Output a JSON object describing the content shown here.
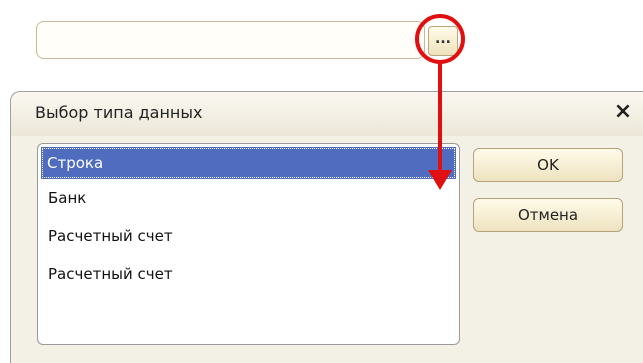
{
  "field": {
    "value": "",
    "ellipsis_label": "..."
  },
  "dialog": {
    "title": "Выбор типа данных",
    "close_label": "×",
    "items": [
      {
        "label": "Строка",
        "selected": true
      },
      {
        "label": "Банк",
        "selected": false
      },
      {
        "label": "Расчетный счет",
        "selected": false
      },
      {
        "label": "Расчетный счет",
        "selected": false
      }
    ],
    "ok_label": "OK",
    "cancel_label": "Отмена"
  },
  "colors": {
    "highlight": "#e01010",
    "selection": "#4f6cbf"
  },
  "icons": {
    "close": "close-icon",
    "ellipsis": "ellipsis-icon"
  }
}
